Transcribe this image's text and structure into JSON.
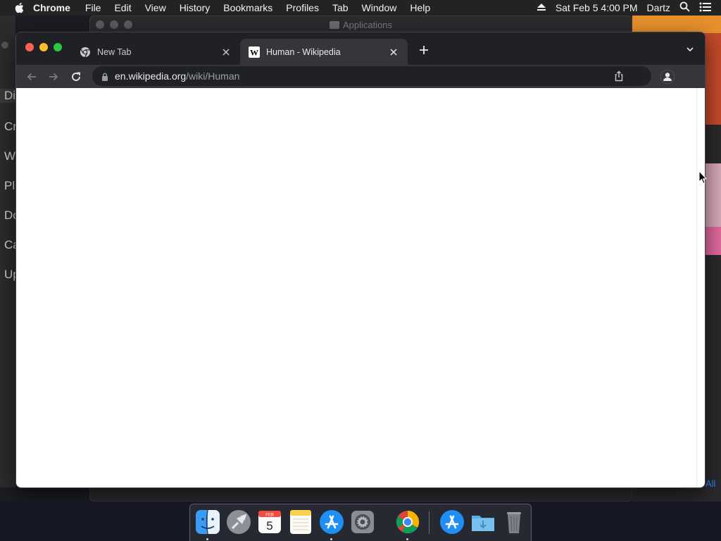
{
  "menubar": {
    "app_name": "Chrome",
    "items": [
      "File",
      "Edit",
      "View",
      "History",
      "Bookmarks",
      "Profiles",
      "Tab",
      "Window",
      "Help"
    ],
    "clock": "Sat Feb 5  4:00 PM",
    "user": "Dartz"
  },
  "background": {
    "window_title": "Applications",
    "sidebar_fragments": [
      "Di",
      "Cr",
      "W",
      "Pl",
      "Do",
      "Ca",
      "Up"
    ],
    "right_link_fragment": "All"
  },
  "browser": {
    "tabs": [
      {
        "title": "New Tab",
        "favicon": "chrome-icon",
        "active": false
      },
      {
        "title": "Human - Wikipedia",
        "favicon": "wikipedia-icon",
        "active": true
      }
    ],
    "address": {
      "host": "en.wikipedia.org",
      "path": "/wiki/Human"
    }
  },
  "dock": {
    "items": [
      {
        "name": "finder-icon",
        "running": true
      },
      {
        "name": "launchpad-icon",
        "running": false
      },
      {
        "name": "calendar-icon",
        "running": false,
        "month": "FEB",
        "day": "5"
      },
      {
        "name": "notes-icon",
        "running": false
      },
      {
        "name": "app-store-icon",
        "running": true
      },
      {
        "name": "system-preferences-icon",
        "running": false
      },
      {
        "name": "chrome-icon",
        "running": true
      },
      {
        "name": "app-store-folder-icon",
        "running": false
      },
      {
        "name": "downloads-folder-icon",
        "running": false
      },
      {
        "name": "trash-icon",
        "running": false
      }
    ]
  },
  "colors": {
    "chrome_frame": "#202124",
    "chrome_toolbar": "#35363a",
    "traffic_red": "#ff5f57",
    "traffic_yellow": "#febc2e",
    "traffic_green": "#28c840"
  }
}
